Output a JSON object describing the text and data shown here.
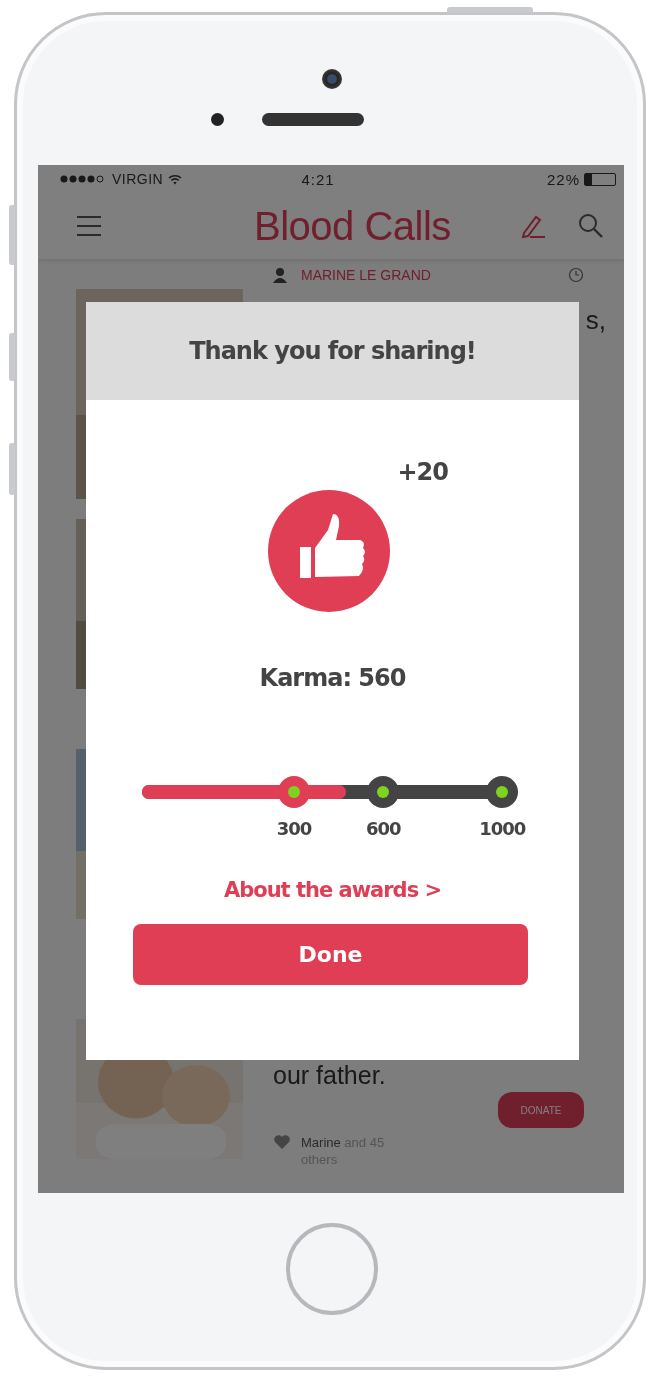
{
  "status_bar": {
    "carrier": "VIRGIN",
    "time": "4:21",
    "battery": "22%"
  },
  "app_bar": {
    "title": "Blood Calls"
  },
  "feed": [
    {
      "kind": "header",
      "author": "MARINE LE GRAND",
      "headline": "s,"
    },
    {
      "kind": "blank"
    },
    {
      "kind": "blank"
    },
    {
      "kind": "footer",
      "headline": "our father.",
      "button": "DONATE",
      "likes": "**Marine** and 45 others"
    }
  ],
  "dialog": {
    "title": "Thank you for sharing!",
    "bonus": "+20",
    "karma": "Karma: 560",
    "progress": {
      "level": 0.55,
      "milestones": [
        {
          "label": "300",
          "reached": true
        },
        {
          "label": "600",
          "reached": false
        },
        {
          "label": "1000",
          "reached": false
        }
      ]
    },
    "link": "About the awards >",
    "button": "Done"
  }
}
